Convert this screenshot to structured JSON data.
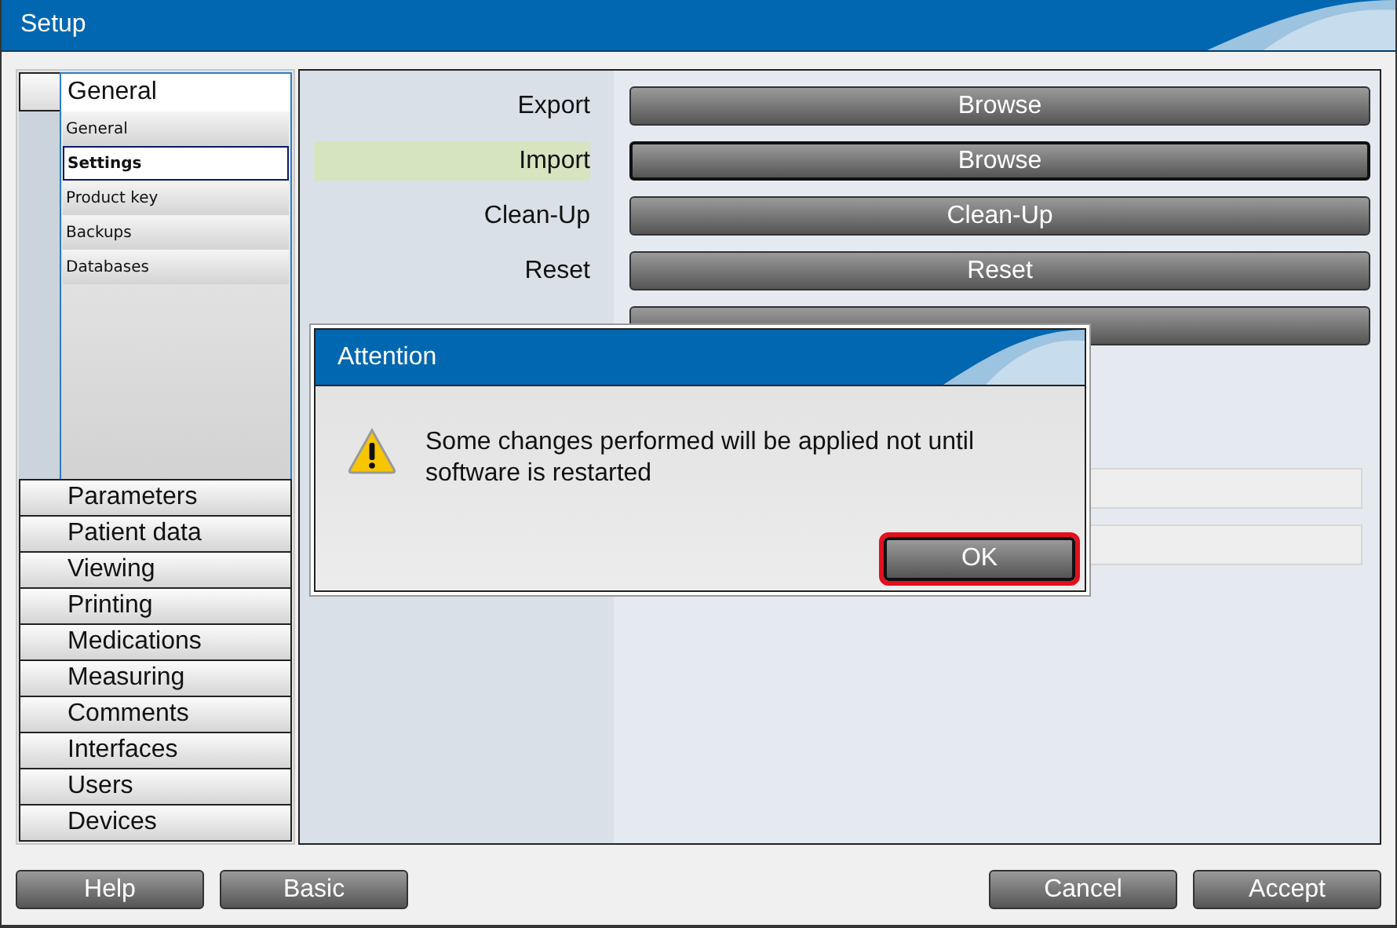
{
  "window": {
    "title": "Setup"
  },
  "sidebar": {
    "header": {
      "label": "General",
      "selected": true
    },
    "sub_items": [
      {
        "label": "General",
        "selected": false
      },
      {
        "label": "Settings",
        "selected": true
      },
      {
        "label": "Product key",
        "selected": false
      },
      {
        "label": "Backups",
        "selected": false
      },
      {
        "label": "Databases",
        "selected": false
      }
    ],
    "categories": [
      {
        "label": "Parameters"
      },
      {
        "label": "Patient data"
      },
      {
        "label": "Viewing"
      },
      {
        "label": "Printing"
      },
      {
        "label": "Medications"
      },
      {
        "label": "Measuring"
      },
      {
        "label": "Comments"
      },
      {
        "label": "Interfaces"
      },
      {
        "label": "Users"
      },
      {
        "label": "Devices"
      }
    ]
  },
  "content": {
    "rows": [
      {
        "label": "Export",
        "highlighted": false,
        "focused": false,
        "button": "Browse"
      },
      {
        "label": "Import",
        "highlighted": true,
        "focused": true,
        "button": "Browse"
      },
      {
        "label": "Clean-Up",
        "highlighted": false,
        "focused": false,
        "button": "Clean-Up"
      },
      {
        "label": "Reset",
        "highlighted": false,
        "focused": false,
        "button": "Reset"
      },
      {
        "highlighted": false,
        "focused": false
      }
    ],
    "fields": [
      {
        "kind": "text"
      },
      {
        "kind": "text"
      }
    ]
  },
  "dialog": {
    "title": "Attention",
    "message": "Some changes performed will be applied not until software is restarted",
    "buttons": [
      {
        "label": "OK",
        "focused": true
      }
    ]
  },
  "footer": {
    "left_buttons": [
      "Help",
      "Basic"
    ],
    "right_buttons": [
      "Cancel",
      "Accept"
    ]
  }
}
